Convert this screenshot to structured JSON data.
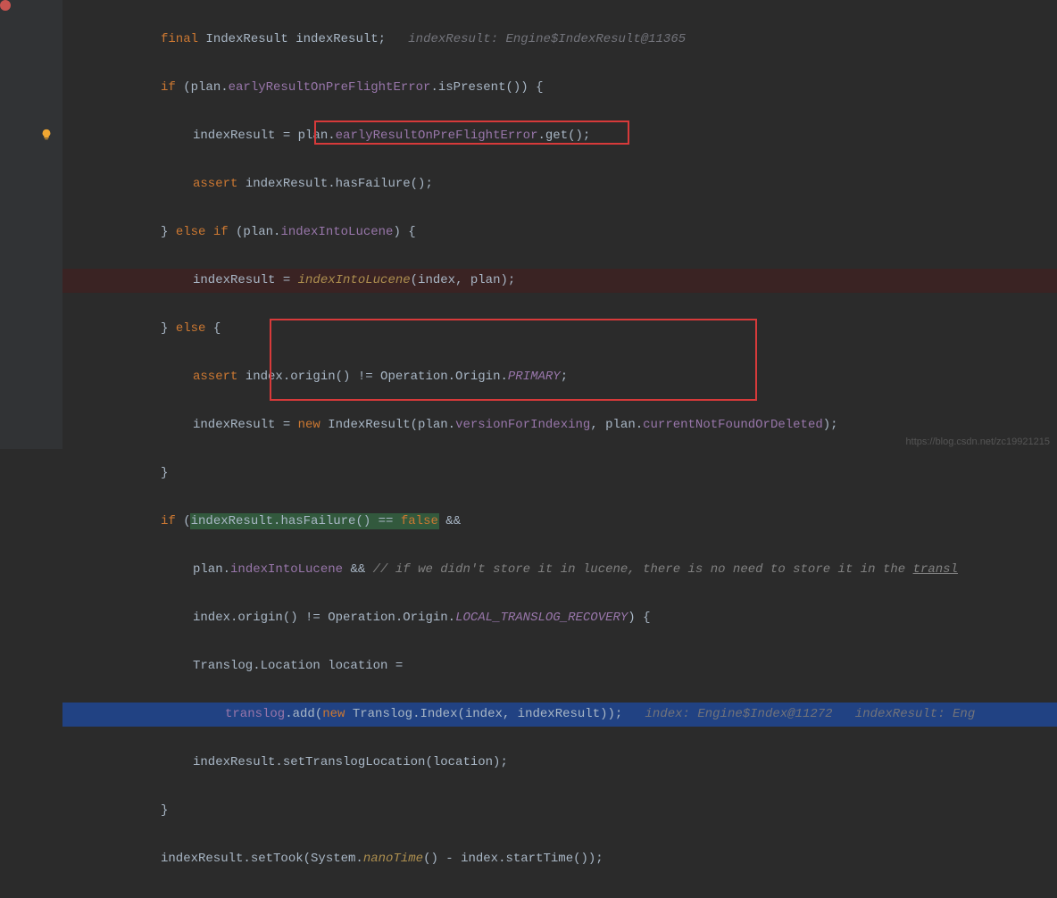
{
  "code": {
    "line1": {
      "kw": "final",
      "type": "IndexResult",
      "var": "indexResult",
      "hint": "indexResult: Engine$IndexResult@11365"
    },
    "line2": {
      "kw": "if",
      "text1": " (plan.",
      "field1": "earlyResultOnPreFlightError",
      "text2": ".isPresent()) {"
    },
    "line3": {
      "text1": "indexResult = plan.",
      "field1": "earlyResultOnPreFlightError",
      "text2": ".get();"
    },
    "line4": {
      "kw": "assert",
      "text1": " indexResult.hasFailure();"
    },
    "line5": {
      "text1": "} ",
      "kw1": "else if",
      "text2": " (plan.",
      "field1": "indexIntoLucene",
      "text3": ") {"
    },
    "line6": {
      "text1": "indexResult = ",
      "method": "indexIntoLucene",
      "text2": "(index, plan);"
    },
    "line7": {
      "text1": "} ",
      "kw1": "else",
      "text2": " {"
    },
    "line8": {
      "kw": "assert",
      "text1": " index.origin() != Operation.Origin.",
      "const1": "PRIMARY",
      "text2": ";"
    },
    "line9": {
      "text1": "indexResult = ",
      "kw1": "new",
      "text2": " IndexResult(plan.",
      "field1": "versionForIndexing",
      "text3": ", plan.",
      "field2": "currentNotFoundOrDeleted",
      "text4": ");"
    },
    "line10": {
      "text1": "}"
    },
    "line11": {
      "kw": "if",
      "text1": " (",
      "hl1": "indexResult.hasFailure() == ",
      "kw2": "false",
      "text2": " &&"
    },
    "line12": {
      "text1": "plan.",
      "field1": "indexIntoLucene",
      "text2": " && ",
      "comment": "// if we didn't store it in lucene, there is no need to store it in the ",
      "underline": "transl"
    },
    "line13": {
      "text1": "index.origin() != Operation.Origin.",
      "const1": "LOCAL_TRANSLOG_RECOVERY",
      "text2": ") {"
    },
    "line14": {
      "text1": "Translog.Location location ="
    },
    "line15": {
      "field1": "translog",
      "text1": ".add(",
      "kw1": "new",
      "text2": " Translog.Index(index, indexResult));",
      "hint1": "index: Engine$Index@11272",
      "hint2": "indexResult: Eng"
    },
    "line16": {
      "text1": "indexResult.setTranslogLocation(location);"
    },
    "line17": {
      "text1": "}"
    },
    "line18": {
      "text1": "indexResult.setTook(System.",
      "method": "nanoTime",
      "text2": "() - index.startTime());"
    }
  },
  "watermark": "https://blog.csdn.net/zc19921215"
}
